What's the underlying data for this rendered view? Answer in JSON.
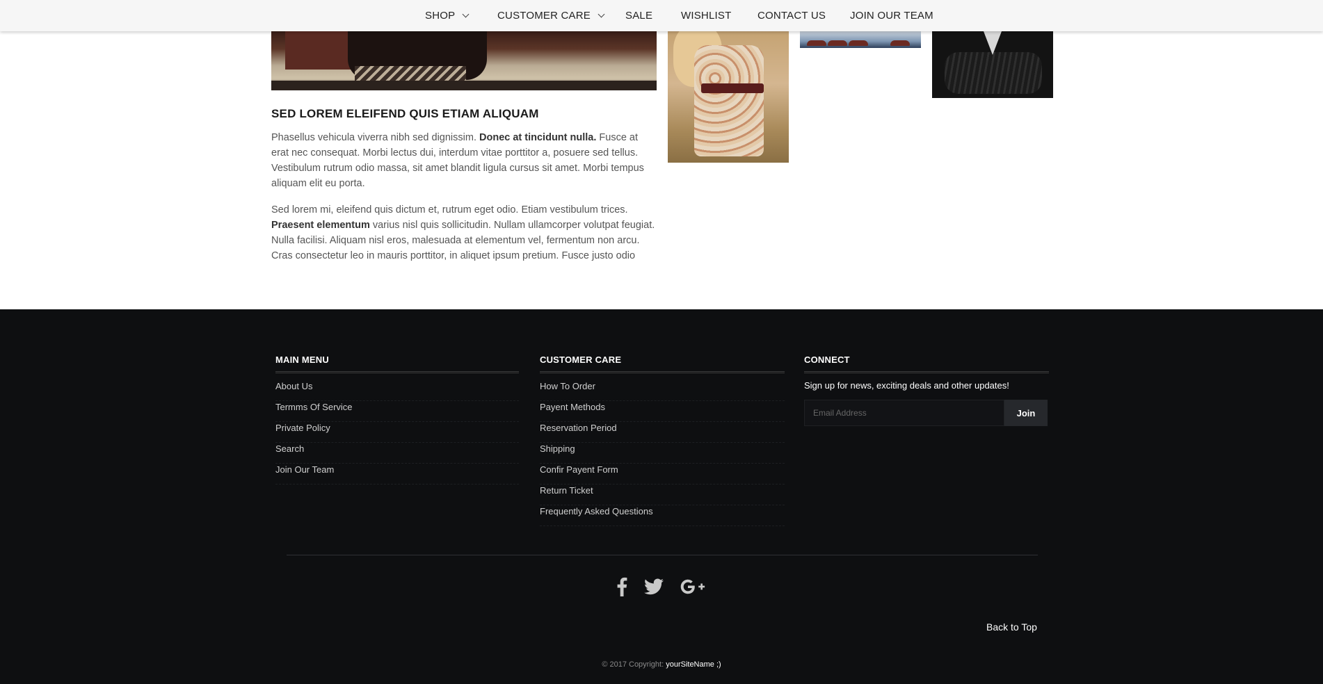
{
  "nav": {
    "items": [
      {
        "label": "SHOP",
        "has_dropdown": true
      },
      {
        "label": "CUSTOMER CARE",
        "has_dropdown": true
      },
      {
        "label": "SALE",
        "has_dropdown": false
      },
      {
        "label": "WISHLIST",
        "has_dropdown": false
      },
      {
        "label": "CONTACT US",
        "has_dropdown": false
      },
      {
        "label": "JOIN OUR TEAM",
        "has_dropdown": false
      }
    ]
  },
  "article": {
    "title": "SED LOREM ELEIFEND QUIS ETIAM ALIQUAM",
    "p1_a": "Phasellus vehicula viverra nibh sed dignissim. ",
    "p1_bold": "Donec at tincidunt nulla.",
    "p1_b": " Fusce at erat nec consequat. Morbi lectus dui, interdum vitae porttitor a, posuere sed tellus. Vestibulum rutrum odio massa, sit amet blandit ligula cursus sit amet. Morbi tempus aliquam elit eu porta.",
    "p2_a": "Sed lorem mi, eleifend quis dictum et, rutrum eget odio. Etiam vestibulum trices. ",
    "p2_bold": "Praesent elementum",
    "p2_b": " varius nisl quis sollicitudin. Nullam ullamcorper volutpat feugiat. Nulla facilisi. Aliquam nisl eros, malesuada at elementum vel, fermentum non arcu. Cras consectetur leo in mauris porttitor, in aliquet ipsum pretium. Fusce justo odio"
  },
  "footer": {
    "main_menu": {
      "title": "MAIN MENU",
      "links": [
        "About Us",
        "Termms Of Service",
        "Private Policy",
        "Search",
        "Join Our Team"
      ]
    },
    "customer_care": {
      "title": "CUSTOMER CARE",
      "links": [
        "How To Order",
        "Payent Methods",
        "Reservation Period",
        "Shipping",
        "Confir Payent Form",
        "Return Ticket",
        "Frequently Asked Questions"
      ]
    },
    "connect": {
      "title": "CONNECT",
      "text": "Sign up for news, exciting deals and other updates!",
      "email_placeholder": "Email Address",
      "button_label": "Join"
    },
    "social_icons": [
      "facebook-icon",
      "twitter-icon",
      "google-plus-icon"
    ],
    "back_to_top": "Back to Top",
    "copyright_prefix": "© 2017 Copyright: ",
    "copyright_site": "yourSiteName",
    "copyright_suffix": " ;)"
  },
  "colors": {
    "footer_bg": "#0e0f11",
    "nav_bg": "#f6f6f6"
  }
}
